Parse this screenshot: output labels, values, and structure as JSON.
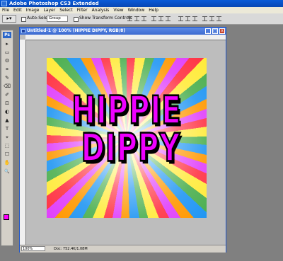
{
  "window": {
    "title": "Adobe Photoshop CS3 Extended"
  },
  "menu": [
    "File",
    "Edit",
    "Image",
    "Layer",
    "Select",
    "Filter",
    "Analysis",
    "View",
    "Window",
    "Help"
  ],
  "options": {
    "auto_select_label": "Auto-Select:",
    "auto_select_value": "Group",
    "transform_label": "Show Transform Controls"
  },
  "toolbox": {
    "logo": "Ps",
    "tools": [
      "▸",
      "▭",
      "ʘ",
      "⌗",
      "✎",
      "⌫",
      "✐",
      "⊡",
      "◐",
      "▲",
      "T",
      "⌖",
      "⬚",
      "☐",
      "✋",
      "🔍"
    ]
  },
  "document": {
    "title": "Untitled-1 @ 100% (HIPPIE DIPPY, RGB/8)",
    "text_line1": "HIPPIE",
    "text_line2": "DIPPY",
    "zoom": "100%",
    "doc_size": "Doc: 752.4K/1.08M"
  },
  "colors": {
    "foreground": "#ff00ff",
    "text_fill": "#ee00ff"
  }
}
